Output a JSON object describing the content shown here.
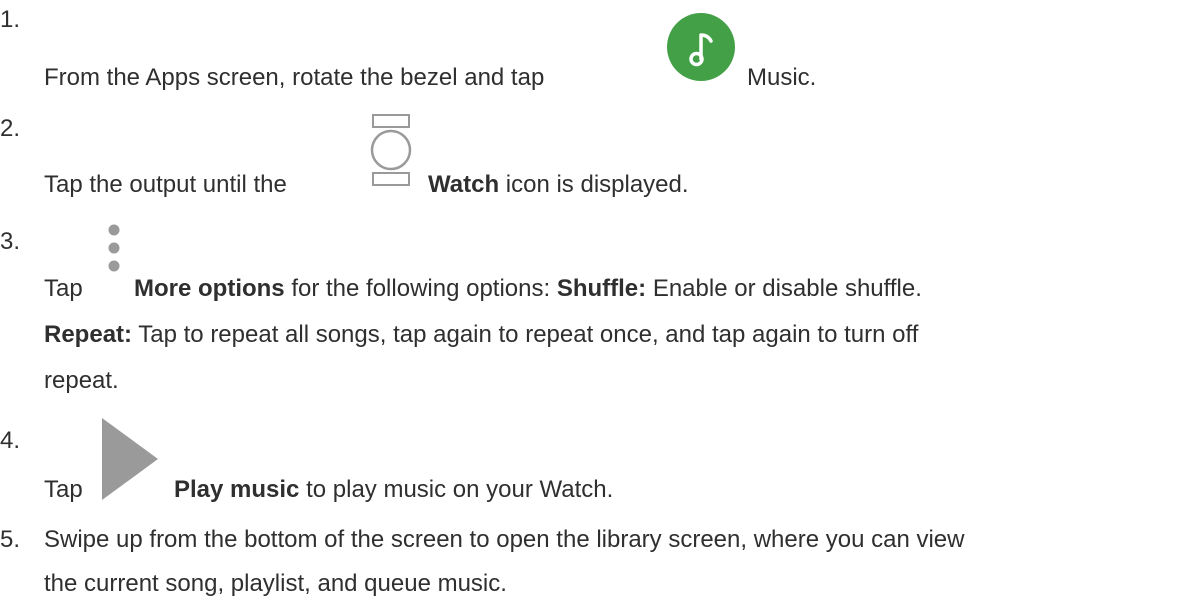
{
  "steps": [
    {
      "number": "1.",
      "text_before": "From the Apps screen, rotate the bezel and tap",
      "icon": "music-app-icon",
      "text_after": "Music."
    },
    {
      "number": "2.",
      "text_before": "Tap the output until the",
      "icon": "watch-output-icon",
      "bold": "Watch",
      "text_after": "icon is displayed."
    },
    {
      "number": "3.",
      "text_before": "Tap",
      "icon": "more-options-icon",
      "bold": "More options",
      "text_mid": "for the following options:",
      "bold2": "Shuffle:",
      "text_after": "Enable or disable shuffle.",
      "bold3": "Repeat:",
      "text_line2": "Tap to repeat all songs, tap again to repeat once, and tap again to turn off",
      "text_line3": "repeat."
    },
    {
      "number": "4.",
      "text_before": "Tap",
      "icon": "play-icon",
      "bold": "Play music",
      "text_after": "to play music on your Watch."
    },
    {
      "number": "5.",
      "text_line1": "Swipe up from the bottom of the screen to open the library screen, where you can view",
      "text_line2": "the current song, playlist, and queue music."
    }
  ],
  "colors": {
    "music_green": "#43a047",
    "icon_gray": "#9a9a9a",
    "text": "#2f2f2f"
  }
}
